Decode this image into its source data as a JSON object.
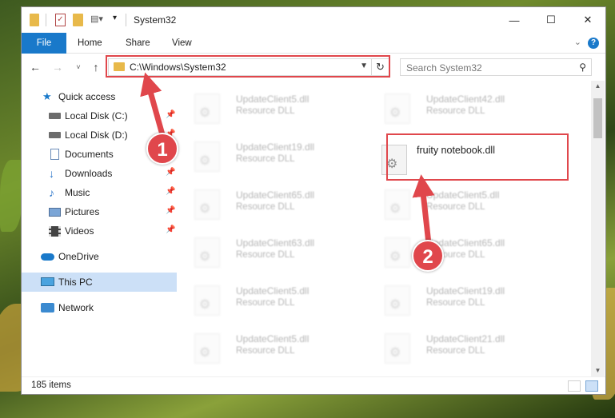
{
  "window": {
    "title": "System32",
    "minimize_glyph": "—",
    "maximize_glyph": "☐",
    "close_glyph": "✕"
  },
  "ribbon": {
    "tabs": [
      "File",
      "Home",
      "Share",
      "View"
    ],
    "help": "?"
  },
  "nav": {
    "address": "C:\\Windows\\System32",
    "search_placeholder": "Search System32"
  },
  "sidebar": {
    "items": [
      {
        "label": "Quick access",
        "icon": "star-icon",
        "pinned": false
      },
      {
        "label": "Local Disk (C:)",
        "icon": "drive-icon",
        "pinned": true
      },
      {
        "label": "Local Disk (D:)",
        "icon": "drive-icon",
        "pinned": true
      },
      {
        "label": "Documents",
        "icon": "document-icon",
        "pinned": false
      },
      {
        "label": "Downloads",
        "icon": "download-icon",
        "pinned": true
      },
      {
        "label": "Music",
        "icon": "music-icon",
        "pinned": true
      },
      {
        "label": "Pictures",
        "icon": "pictures-icon",
        "pinned": true
      },
      {
        "label": "Videos",
        "icon": "video-icon",
        "pinned": true
      },
      {
        "label": "OneDrive",
        "icon": "cloud-icon",
        "pinned": false
      },
      {
        "label": "This PC",
        "icon": "pc-icon",
        "pinned": false
      },
      {
        "label": "Network",
        "icon": "network-icon",
        "pinned": false
      }
    ]
  },
  "files": {
    "left_column": [
      {
        "name": "UpdateClient5.dll",
        "type": "Resource DLL"
      },
      {
        "name": "UpdateClient19.dll",
        "type": "Resource DLL"
      },
      {
        "name": "UpdateClient65.dll",
        "type": "Resource DLL"
      },
      {
        "name": "UpdateClient63.dll",
        "type": "Resource DLL"
      },
      {
        "name": "UpdateClient5.dll",
        "type": "Resource DLL"
      },
      {
        "name": "UpdateClient5.dll",
        "type": "Resource DLL"
      }
    ],
    "right_column": [
      {
        "name": "UpdateClient42.dll",
        "type": "Resource DLL"
      },
      {
        "name": "fruity notebook.dll",
        "type": ""
      },
      {
        "name": "UpdateClient5.dll",
        "type": "Resource DLL"
      },
      {
        "name": "UpdateClient65.dll",
        "type": "Resource DLL"
      },
      {
        "name": "UpdateClient19.dll",
        "type": "Resource DLL"
      },
      {
        "name": "UpdateClient21.dll",
        "type": "Resource DLL"
      }
    ]
  },
  "status": {
    "item_count": "185 items"
  },
  "callouts": {
    "step1": "1",
    "step2": "2",
    "color": "#e0474c"
  }
}
